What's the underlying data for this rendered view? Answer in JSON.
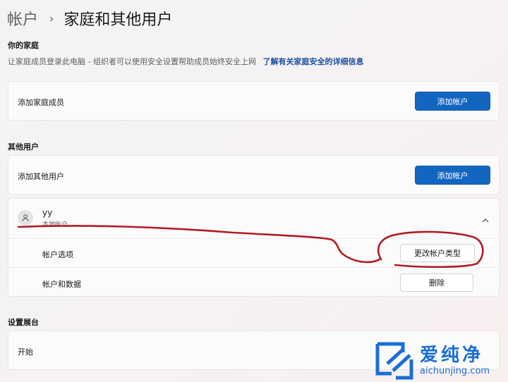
{
  "breadcrumb": {
    "parent": "帐户",
    "separator": "›",
    "current": "家庭和其他用户"
  },
  "family": {
    "title": "你的家庭",
    "description": "让家庭成员登录此电脑 - 组织者可以使用安全设置帮助成员始终安全上网",
    "link": "了解有关家庭安全的详细信息",
    "add_row_label": "添加家庭成员",
    "add_button": "添加帐户"
  },
  "other_users": {
    "title": "其他用户",
    "add_row_label": "添加其他用户",
    "add_button": "添加帐户",
    "user": {
      "name": "yy",
      "type": "本地帐户",
      "account_options_label": "帐户选项",
      "change_type_button": "更改帐户类型",
      "account_data_label": "帐户和数据",
      "remove_button": "删除"
    }
  },
  "kiosk": {
    "title": "设置展台",
    "row_label": "开始"
  },
  "watermark": {
    "cn": "爱纯净",
    "en": "aichunjing.com"
  },
  "colors": {
    "accent": "#1366bf",
    "annotation": "#b01c22",
    "watermark": "#1a6fd6"
  },
  "icons": {
    "breadcrumb_separator": "chevron-right-icon",
    "avatar": "person-icon",
    "expander": "chevron-up-icon"
  }
}
